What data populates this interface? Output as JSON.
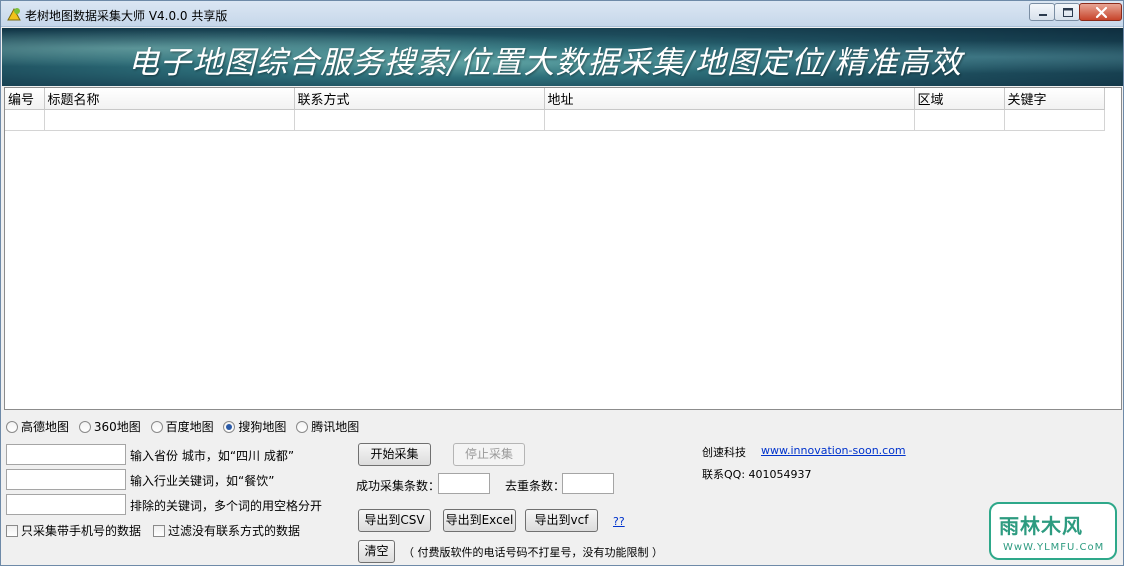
{
  "window": {
    "title": "老树地图数据采集大师 V4.0.0 共享版"
  },
  "banner": {
    "text": "电子地图综合服务搜索/位置大数据采集/地图定位/精准高效"
  },
  "table": {
    "columns": [
      "编号",
      "标题名称",
      "联系方式",
      "地址",
      "区域",
      "关键字"
    ]
  },
  "sources": {
    "options": [
      "高德地图",
      "360地图",
      "百度地图",
      "搜狗地图",
      "腾讯地图"
    ],
    "selected": "搜狗地图"
  },
  "form": {
    "city_input": {
      "value": "",
      "label": "输入省份 城市，如“四川 成都”"
    },
    "keyword_input": {
      "value": "",
      "label": "输入行业关键词，如“餐饮”"
    },
    "exclude_input": {
      "value": "",
      "label": "排除的关键词，多个词的用空格分开"
    },
    "only_mobile_label": "只采集带手机号的数据",
    "filter_no_contact_label": "过滤没有联系方式的数据"
  },
  "actions": {
    "start_label": "开始采集",
    "stop_label": "停止采集",
    "success_count_label": "成功采集条数：",
    "success_count_value": "",
    "dedupe_count_label": "去重条数：",
    "dedupe_count_value": "",
    "export_csv_label": "导出到CSV",
    "export_excel_label": "导出到Excel",
    "export_vcf_label": "导出到vcf",
    "help_link": "??",
    "clear_label": "清空",
    "notice": "（ 付费版软件的电话号码不打星号，没有功能限制 ）"
  },
  "company": {
    "name": "创速科技",
    "website": "www.innovation-soon.com",
    "qq": "联系QQ: 401054937"
  },
  "watermark": {
    "main": "雨林木风",
    "sub": "WwW.YLMFU.CoM"
  }
}
